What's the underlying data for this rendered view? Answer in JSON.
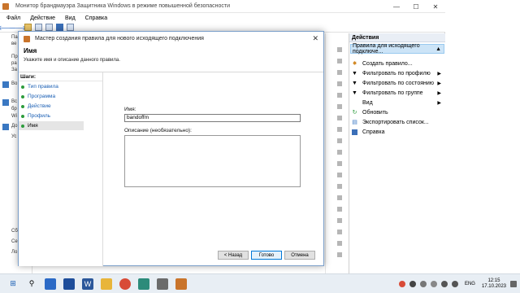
{
  "window": {
    "title": "Монитор брандмауэра Защитника Windows в режиме повышенной безопасности"
  },
  "menu": [
    "Файл",
    "Действие",
    "Вид",
    "Справка"
  ],
  "tree": [
    "Па",
    "ве",
    "Пр",
    "ра",
    "За",
    "Во",
    "Вс",
    "бр",
    "Wi",
    "До",
    "Ус",
    "Сб",
    "Се",
    "Ло"
  ],
  "actions": {
    "header": "Действия",
    "selected": "Правила для исходящего подключе...",
    "items": [
      {
        "label": "Создать правило...",
        "icon": "new-rule-icon",
        "submenu": false
      },
      {
        "label": "Фильтровать по профилю",
        "icon": "filter-icon",
        "submenu": true
      },
      {
        "label": "Фильтровать по состоянию",
        "icon": "filter-icon",
        "submenu": true
      },
      {
        "label": "Фильтровать по группе",
        "icon": "filter-icon",
        "submenu": true
      },
      {
        "label": "Вид",
        "icon": "",
        "submenu": true
      },
      {
        "label": "Обновить",
        "icon": "refresh-icon",
        "submenu": false
      },
      {
        "label": "Экспортировать список...",
        "icon": "export-icon",
        "submenu": false
      },
      {
        "label": "Справка",
        "icon": "help-icon",
        "submenu": false
      }
    ]
  },
  "dialog": {
    "title": "Мастер создания правила для нового исходящего подключения",
    "heading": "Имя",
    "subheading": "Укажите имя и описание данного правила.",
    "steps_label": "Шаги:",
    "steps": [
      "Тип правила",
      "Программа",
      "Действие",
      "Профиль",
      "Имя"
    ],
    "name_label": "Имя:",
    "name_value": "bandoffm",
    "desc_label": "Описание (необязательно):",
    "desc_value": "",
    "back": "< Назад",
    "finish": "Готово",
    "cancel": "Отмена"
  },
  "taskbar": {
    "lang": "ENG",
    "time": "12:15",
    "date": "17.10.2023"
  },
  "colors": {
    "accent": "#0078d7",
    "link": "#1a5fb4",
    "step_dot": "#2d9c3d",
    "selection": "#cce4f7"
  }
}
